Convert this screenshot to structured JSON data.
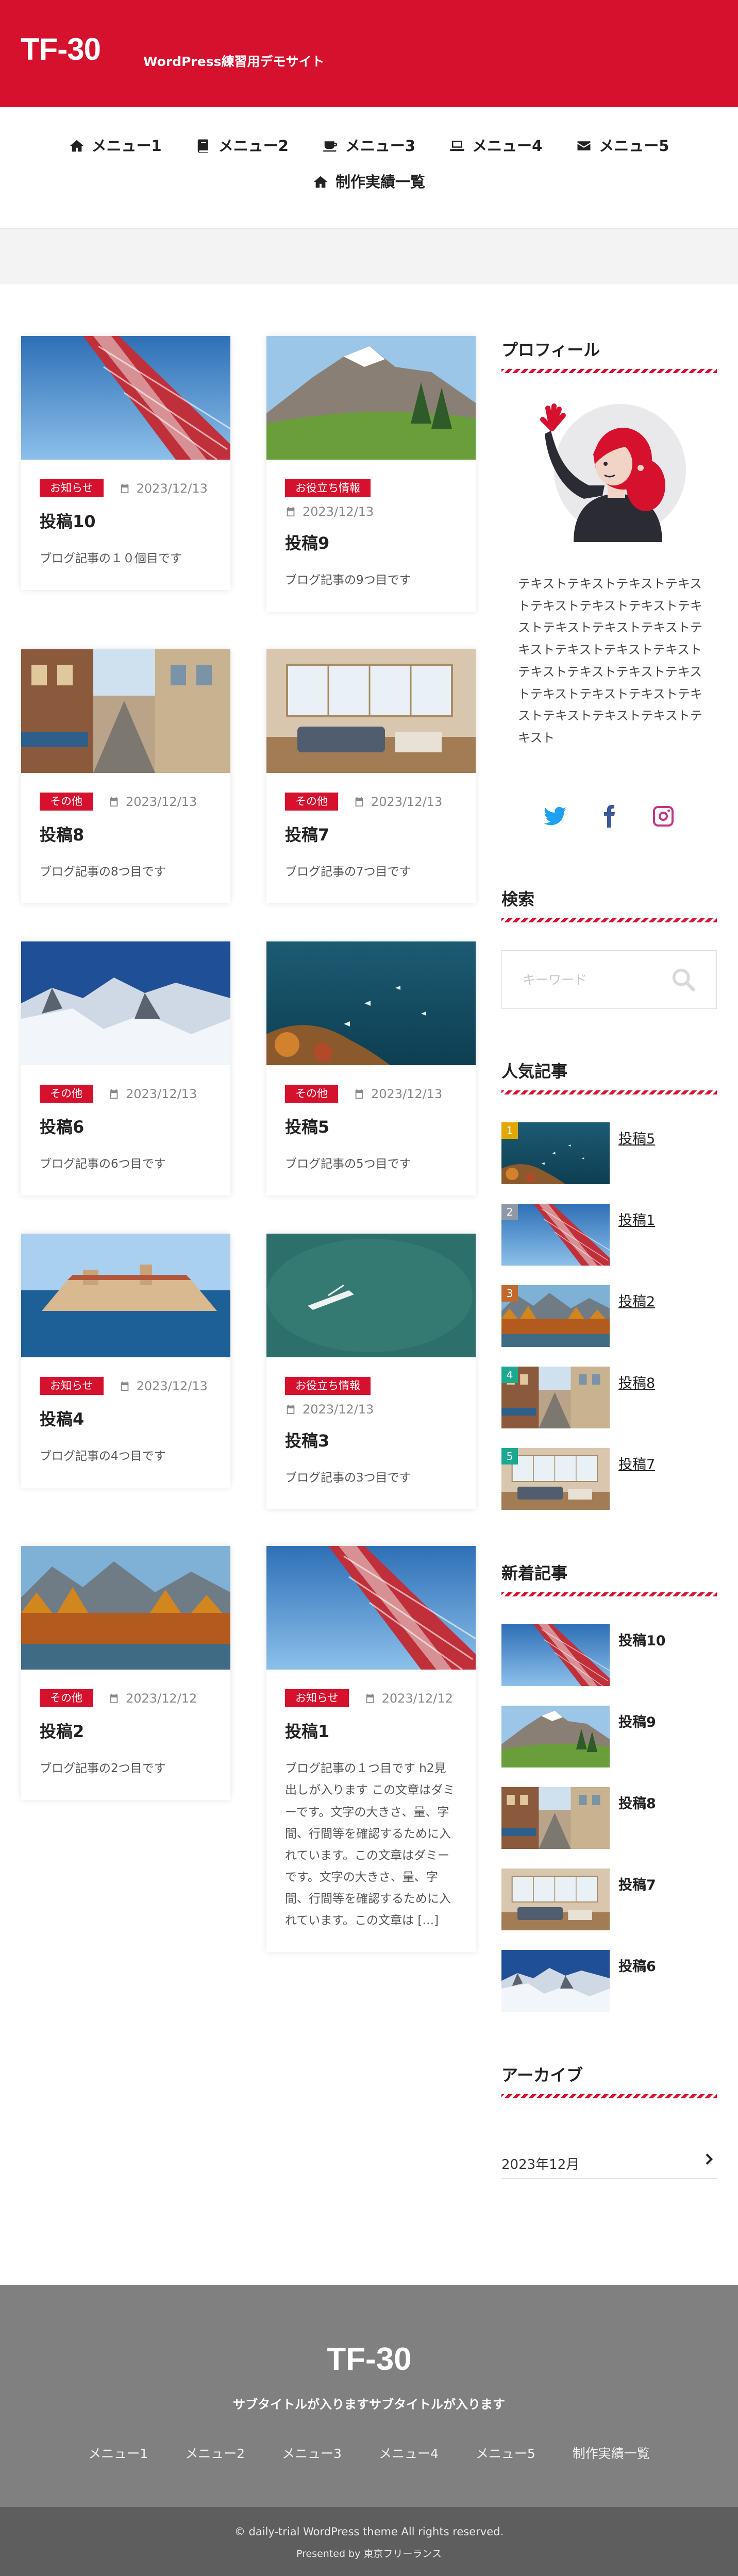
{
  "header": {
    "logo": "TF-30",
    "tagline": "WordPress練習用デモサイト"
  },
  "nav": [
    {
      "label": "メニュー1",
      "icon": "home-icon"
    },
    {
      "label": "メニュー2",
      "icon": "book-icon"
    },
    {
      "label": "メニュー3",
      "icon": "coffee-icon"
    },
    {
      "label": "メニュー4",
      "icon": "laptop-icon"
    },
    {
      "label": "メニュー5",
      "icon": "envelope-icon"
    },
    {
      "label": "制作実績一覧",
      "icon": "home-icon"
    }
  ],
  "posts": [
    {
      "category": "お知らせ",
      "date": "2023/12/13",
      "title": "投稿10",
      "excerpt": "ブログ記事の１０個目です",
      "image": "tower"
    },
    {
      "category": "お役立ち情報",
      "date": "2023/12/13",
      "title": "投稿9",
      "excerpt": "ブログ記事の9つ目です",
      "image": "mountain"
    },
    {
      "category": "その他",
      "date": "2023/12/13",
      "title": "投稿8",
      "excerpt": "ブログ記事の8つ目です",
      "image": "street"
    },
    {
      "category": "その他",
      "date": "2023/12/13",
      "title": "投稿7",
      "excerpt": "ブログ記事の7つ目です",
      "image": "room"
    },
    {
      "category": "その他",
      "date": "2023/12/13",
      "title": "投稿6",
      "excerpt": "ブログ記事の6つ目です",
      "image": "snow"
    },
    {
      "category": "その他",
      "date": "2023/12/13",
      "title": "投稿5",
      "excerpt": "ブログ記事の5つ目です",
      "image": "sea"
    },
    {
      "category": "お知らせ",
      "date": "2023/12/13",
      "title": "投稿4",
      "excerpt": "ブログ記事の4つ目です",
      "image": "city"
    },
    {
      "category": "お役立ち情報",
      "date": "2023/12/13",
      "title": "投稿3",
      "excerpt": "ブログ記事の3つ目です",
      "image": "green"
    },
    {
      "category": "その他",
      "date": "2023/12/12",
      "title": "投稿2",
      "excerpt": "ブログ記事の2つ目です",
      "image": "autumn"
    },
    {
      "category": "お知らせ",
      "date": "2023/12/12",
      "title": "投稿1",
      "excerpt": "ブログ記事の１つ目です h2見出しが入ります この文章はダミーです。文字の大きさ、量、字間、行間等を確認するために入れています。この文章はダミーです。文字の大きさ、量、字間、行間等を確認するために入れています。この文章は […]",
      "image": "tower"
    }
  ],
  "sidebar": {
    "profile_title": "プロフィール",
    "profile_text": "テキストテキストテキストテキストテキストテキストテキストテキストテキストテキストテキストテキストテキストテキストテキストテキストテキストテキストテキストテキストテキストテキストテキストテキストテキストテキストテキスト",
    "social": [
      {
        "name": "twitter-icon",
        "color": "#1da1f2"
      },
      {
        "name": "facebook-icon",
        "color": "#3b5998"
      },
      {
        "name": "instagram-icon",
        "color": "#c13584"
      }
    ],
    "search_title": "検索",
    "search_placeholder": "キーワード",
    "popular_title": "人気記事",
    "popular": [
      {
        "rank": "1",
        "title": "投稿5",
        "image": "sea",
        "color": "#e0a800"
      },
      {
        "rank": "2",
        "title": "投稿1",
        "image": "tower",
        "color": "#8f98a6"
      },
      {
        "rank": "3",
        "title": "投稿2",
        "image": "autumn",
        "color": "#c06a30"
      },
      {
        "rank": "4",
        "title": "投稿8",
        "image": "street",
        "color": "#1aa88f"
      },
      {
        "rank": "5",
        "title": "投稿7",
        "image": "room",
        "color": "#1aa88f"
      }
    ],
    "recent_title": "新着記事",
    "recent": [
      {
        "title": "投稿10",
        "image": "tower"
      },
      {
        "title": "投稿9",
        "image": "mountain"
      },
      {
        "title": "投稿8",
        "image": "street"
      },
      {
        "title": "投稿7",
        "image": "room"
      },
      {
        "title": "投稿6",
        "image": "snow"
      }
    ],
    "archive_title": "アーカイブ",
    "archive_item": "2023年12月"
  },
  "footer": {
    "logo": "TF-30",
    "subtitle": "サブタイトルが入りますサブタイトルが入ります",
    "nav": [
      "メニュー1",
      "メニュー2",
      "メニュー3",
      "メニュー4",
      "メニュー5",
      "制作実績一覧"
    ],
    "copyright": "© daily-trial WordPress theme All rights reserved.",
    "presented_by": "Presented by 東京フリーランス"
  },
  "colors": {
    "brand": "#d6112e",
    "footer": "#808080",
    "copyright_bar": "#5e5e5e"
  }
}
